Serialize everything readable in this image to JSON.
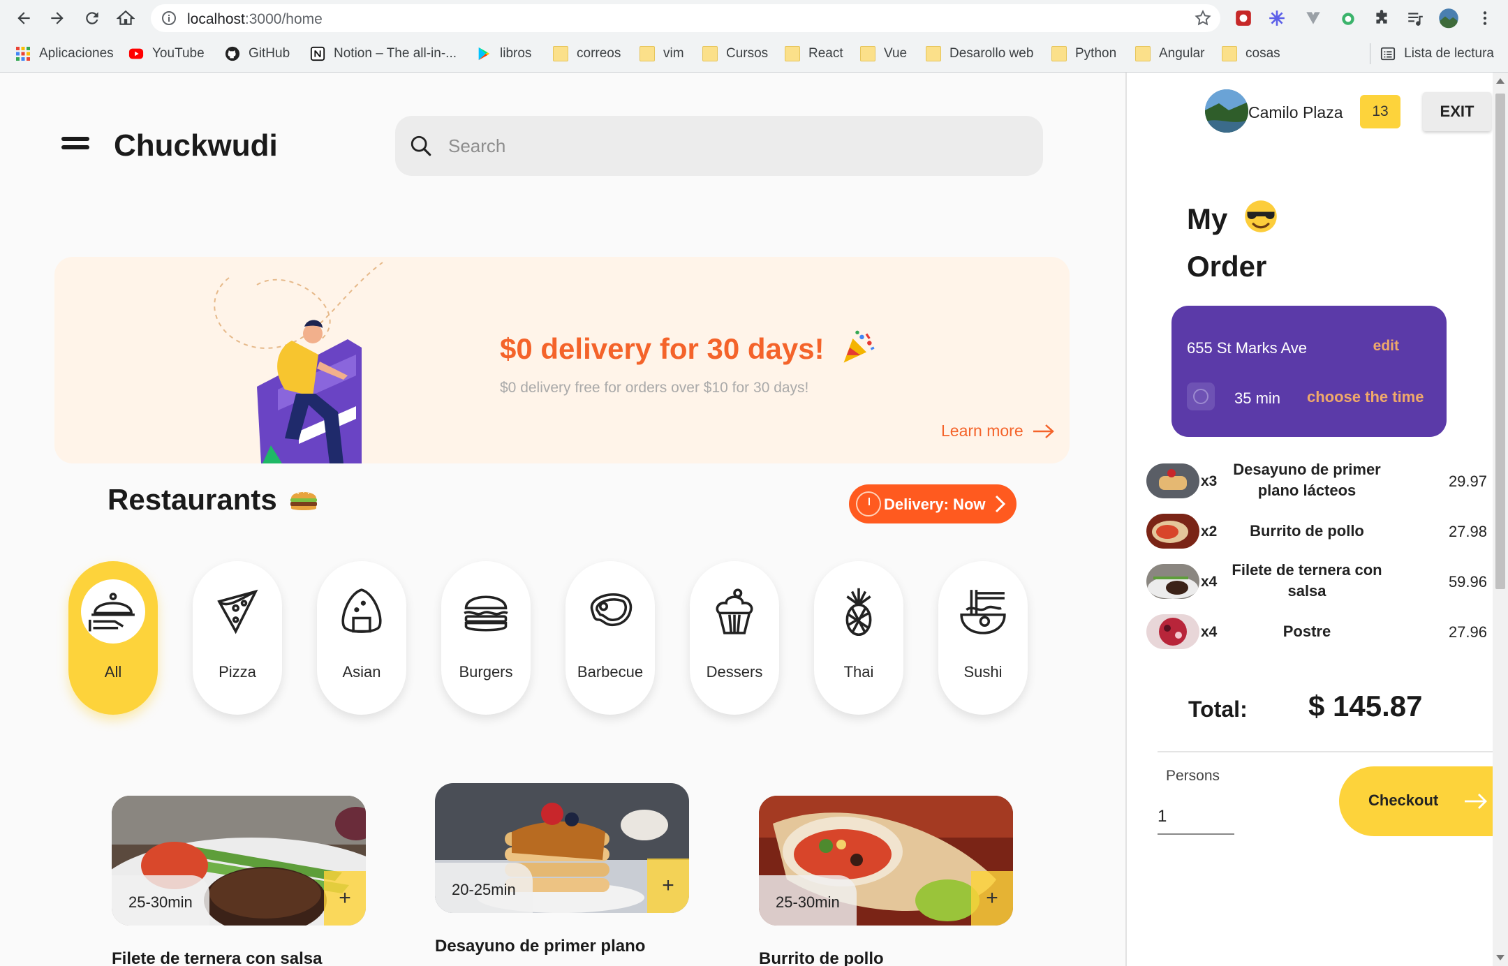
{
  "browser": {
    "url_host": "localhost",
    "url_path": ":3000/home",
    "bookmarks": [
      {
        "label": "Aplicaciones",
        "icon": "apps-grid-icon"
      },
      {
        "label": "YouTube",
        "icon": "youtube-icon"
      },
      {
        "label": "GitHub",
        "icon": "github-icon"
      },
      {
        "label": "Notion – The all-in-...",
        "icon": "notion-icon"
      },
      {
        "label": "libros",
        "icon": "google-play-icon"
      },
      {
        "label": "correos",
        "icon": "folder-icon"
      },
      {
        "label": "vim",
        "icon": "folder-icon"
      },
      {
        "label": "Cursos",
        "icon": "folder-icon"
      },
      {
        "label": "React",
        "icon": "folder-icon"
      },
      {
        "label": "Vue",
        "icon": "folder-icon"
      },
      {
        "label": "Desarollo web",
        "icon": "folder-icon"
      },
      {
        "label": "Python",
        "icon": "folder-icon"
      },
      {
        "label": "Angular",
        "icon": "folder-icon"
      },
      {
        "label": "cosas",
        "icon": "folder-icon"
      }
    ],
    "reading_list": "Lista de lectura"
  },
  "header": {
    "brand": "Chuckwudi",
    "search_placeholder": "Search"
  },
  "banner": {
    "title": "$0 delivery for 30 days!",
    "subtitle": "$0 delivery free for orders over $10 for 30 days!",
    "learn_more": "Learn more"
  },
  "restaurants": {
    "title": "Restaurants",
    "delivery_button": "Delivery: Now",
    "categories": [
      {
        "label": "All",
        "active": true,
        "icon": "food-tray-icon"
      },
      {
        "label": "Pizza",
        "active": false,
        "icon": "pizza-icon"
      },
      {
        "label": "Asian",
        "active": false,
        "icon": "onigiri-icon"
      },
      {
        "label": "Burgers",
        "active": false,
        "icon": "burger-icon"
      },
      {
        "label": "Barbecue",
        "active": false,
        "icon": "steak-icon"
      },
      {
        "label": "Dessers",
        "active": false,
        "icon": "cupcake-icon"
      },
      {
        "label": "Thai",
        "active": false,
        "icon": "pineapple-icon"
      },
      {
        "label": "Sushi",
        "active": false,
        "icon": "noodles-icon"
      }
    ]
  },
  "foods": [
    {
      "name": "Filete de ternera con salsa",
      "time": "25-30min",
      "add": "+"
    },
    {
      "name": "Desayuno de primer plano",
      "time": "20-25min",
      "add": "+"
    },
    {
      "name": "Burrito de pollo",
      "time": "25-30min",
      "add": "+"
    }
  ],
  "user": {
    "name": "Camilo Plaza",
    "badge": "13",
    "exit": "EXIT"
  },
  "order": {
    "title_line1": "My",
    "title_line2": "Order",
    "address": "655 St Marks Ave",
    "edit": "edit",
    "minutes": "35 min",
    "choose_time": "choose the time",
    "items": [
      {
        "qty": "x3",
        "name": "Desayuno de primer plano lácteos",
        "price": "29.97"
      },
      {
        "qty": "x2",
        "name": "Burrito de pollo",
        "price": "27.98"
      },
      {
        "qty": "x4",
        "name": "Filete de ternera con salsa",
        "price": "59.96"
      },
      {
        "qty": "x4",
        "name": "Postre",
        "price": "27.96"
      }
    ],
    "total_label": "Total:",
    "total_value": "$ 145.87",
    "persons_label": "Persons",
    "persons_value": "1",
    "checkout": "Checkout"
  },
  "colors": {
    "accent_yellow": "#fdd33b",
    "accent_orange": "#ff5a1f",
    "card_purple": "#5b3aa8",
    "banner_bg": "#fff4e9"
  }
}
